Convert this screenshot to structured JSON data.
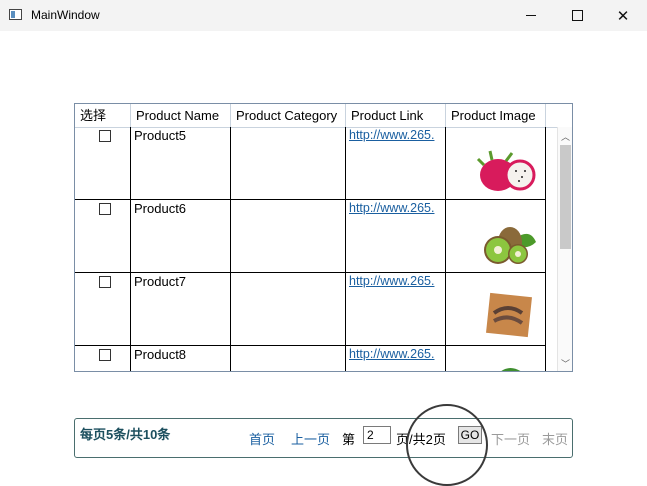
{
  "window": {
    "title": "MainWindow"
  },
  "grid": {
    "columns": [
      "选择",
      "Product Name",
      "Product Category",
      "Product Link",
      "Product Image"
    ],
    "rows": [
      {
        "name": "Product5",
        "category": "",
        "link": "http://www.265.",
        "image": "dragon-fruit-image"
      },
      {
        "name": "Product6",
        "category": "",
        "link": "http://www.265.",
        "image": "kiwi-image"
      },
      {
        "name": "Product7",
        "category": "",
        "link": "http://www.265.",
        "image": "shrimp-image"
      },
      {
        "name": "Product8",
        "category": "",
        "link": "http://www.265.",
        "image": "vegetable-image"
      }
    ]
  },
  "pager": {
    "info": "每页5条/共10条",
    "first": "首页",
    "prev": "上一页",
    "page_prefix": "第",
    "current_page": "2",
    "total": "页/共2页",
    "go": "GO",
    "next": "下一页",
    "last": "末页"
  }
}
